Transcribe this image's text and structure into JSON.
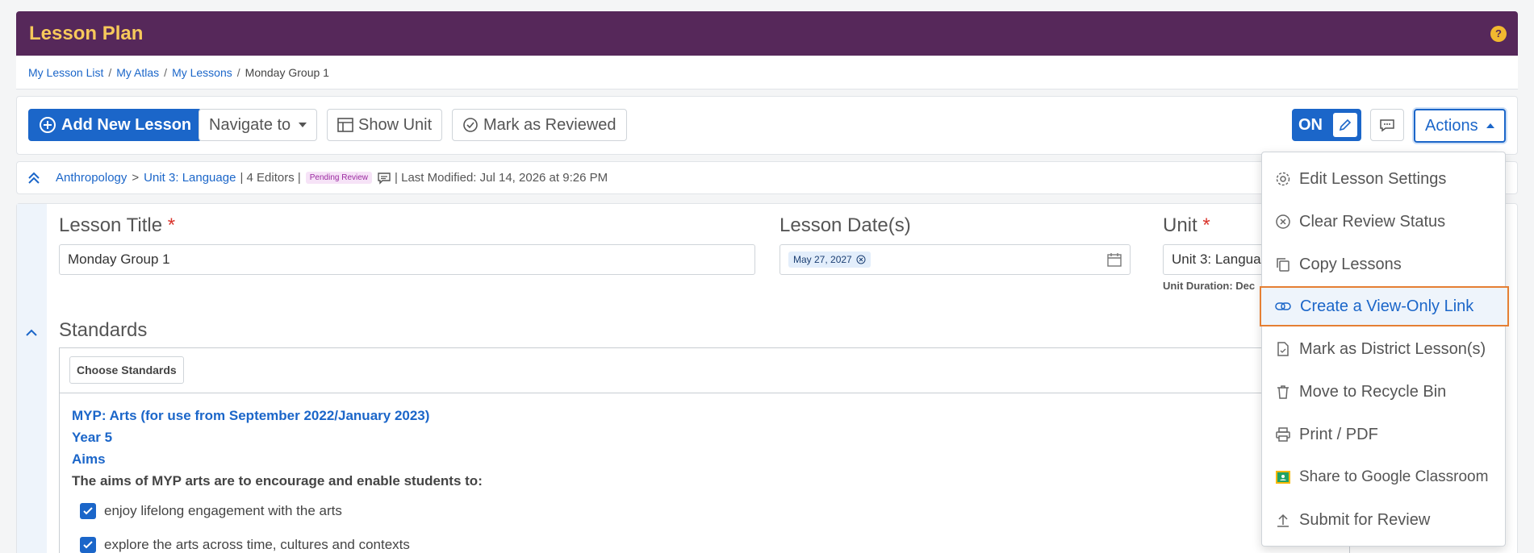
{
  "header": {
    "title": "Lesson Plan",
    "help": "?"
  },
  "breadcrumb": [
    {
      "label": "My Lesson List"
    },
    {
      "label": "My Atlas"
    },
    {
      "label": "My Lessons"
    }
  ],
  "breadcrumb_current": "Monday Group 1",
  "toolbar": {
    "add_label": "Add New Lesson",
    "navigate_label": "Navigate to",
    "show_unit_label": "Show Unit",
    "reviewed_label": "Mark as Reviewed",
    "toggle_label": "ON",
    "actions_label": "Actions"
  },
  "meta": {
    "course": "Anthropology",
    "arrow": ">",
    "unit": "Unit 3: Language",
    "editors": "| 4 Editors |",
    "status": "Pending Review",
    "modified": "| Last Modified: Jul 14, 2026 at 9:26 PM"
  },
  "form": {
    "title_label": "Lesson Title",
    "title_value": "Monday Group 1",
    "date_label": "Lesson Date(s)",
    "date_value": "May 27, 2027",
    "unit_label": "Unit",
    "unit_value": "Unit 3: Langua",
    "unit_duration": "Unit Duration: Dec",
    "required_mark": "*"
  },
  "standards": {
    "heading": "Standards",
    "choose_label": "Choose Standards",
    "set_name": "MYP: Arts (for use from September 2022/January 2023)",
    "year": "Year 5",
    "category": "Aims",
    "intro": "The aims of MYP arts are to encourage and enable students to:",
    "items": [
      {
        "text": "enjoy lifelong engagement with the arts",
        "checked": true
      },
      {
        "text": "explore the arts across time, cultures and contexts",
        "checked": true
      }
    ]
  },
  "actions_menu": [
    {
      "label": "Edit Lesson Settings",
      "icon": "gear-icon"
    },
    {
      "label": "Clear Review Status",
      "icon": "circle-x-icon"
    },
    {
      "label": "Copy Lessons",
      "icon": "copy-icon"
    },
    {
      "label": "Create a View-Only Link",
      "icon": "link-icon",
      "active": true
    },
    {
      "label": "Mark as District Lesson(s)",
      "icon": "document-icon"
    },
    {
      "label": "Move to Recycle Bin",
      "icon": "trash-icon"
    },
    {
      "label": "Print / PDF",
      "icon": "printer-icon"
    },
    {
      "label": "Share to Google Classroom",
      "icon": "google-classroom-icon"
    },
    {
      "label": "Submit for Review",
      "icon": "upload-icon"
    }
  ],
  "colors": {
    "primary": "#1b66c9",
    "banner": "#56285a",
    "banner_text": "#f7c95b",
    "highlight_border": "#e57f33"
  }
}
